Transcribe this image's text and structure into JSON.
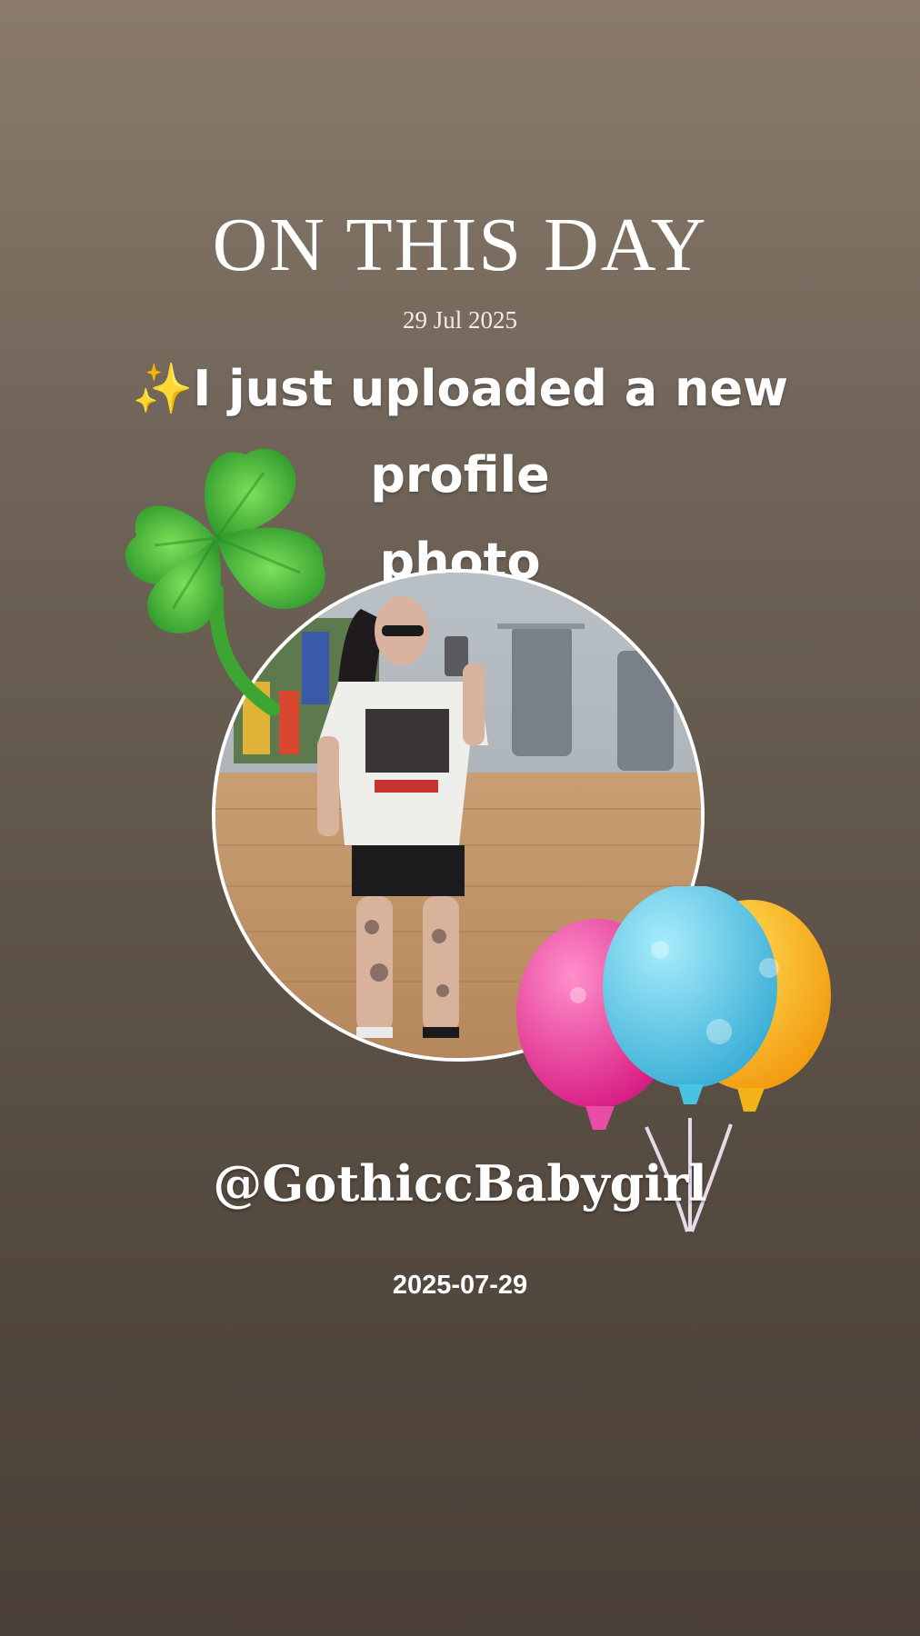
{
  "story": {
    "heading": "ON THIS DAY",
    "date_serif": "29 Jul 2025",
    "caption_sparkle": "✨",
    "caption_line1": "I just uploaded a new profile",
    "caption_line2": "photo",
    "username": "@GothiccBabygirl",
    "date_footer": "2025-07-29"
  },
  "colors": {
    "background_top": "#8a7b6c",
    "background_bottom": "#4b4037",
    "clover": "#5bc43a",
    "balloon_pink": "#e8389a",
    "balloon_blue": "#5fc9e8",
    "balloon_yellow": "#f6b21b"
  },
  "stickers": {
    "clover": "four-leaf-clover-icon",
    "balloons": "balloons-icon"
  }
}
